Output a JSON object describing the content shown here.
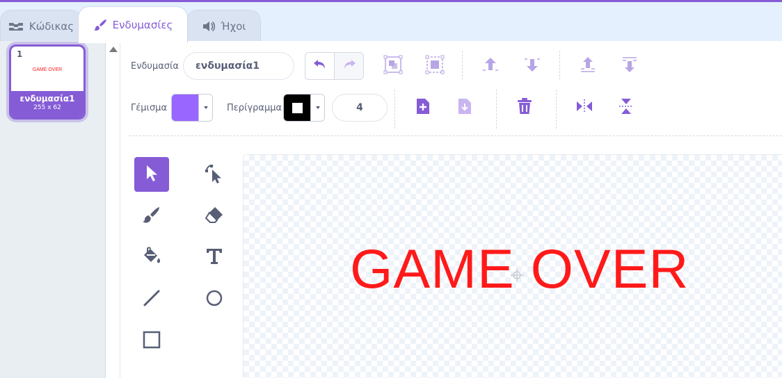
{
  "tabs": [
    {
      "label": "Κώδικας",
      "icon": "code-blocks-icon",
      "active": false
    },
    {
      "label": "Ενδυμασίες",
      "icon": "paintbrush-icon",
      "active": true
    },
    {
      "label": "Ήχοι",
      "icon": "speaker-icon",
      "active": false
    }
  ],
  "sidebar": {
    "costumes": [
      {
        "number": "1",
        "name": "ενδυμασία1",
        "size": "255 x 62",
        "thumb_text": "GAME OVER",
        "selected": true
      }
    ]
  },
  "editor": {
    "costume_label": "Ενδυμασία",
    "costume_name": "ενδυμασία1",
    "fill_label": "Γέμισμα",
    "fill_color": "#9966ff",
    "outline_label": "Περίγραμμα",
    "outline_color": "#000000",
    "outline_width": "4"
  },
  "toolbar": {
    "buttons": [
      "undo-icon",
      "redo-icon",
      "group-icon",
      "ungroup-icon",
      "forward-icon",
      "backward-icon",
      "front-icon",
      "back-icon",
      "paste-icon",
      "copy-icon",
      "delete-icon",
      "flip-horizontal-icon",
      "flip-vertical-icon"
    ]
  },
  "tools": [
    "select-icon",
    "reshape-icon",
    "brush-icon",
    "eraser-icon",
    "fill-icon",
    "text-icon",
    "line-icon",
    "circle-icon",
    "rectangle-icon"
  ],
  "canvas": {
    "text": "GAME OVER",
    "text_color": "#ff1a1a"
  },
  "colors": {
    "accent": "#855cd6",
    "text": "#575e75"
  }
}
